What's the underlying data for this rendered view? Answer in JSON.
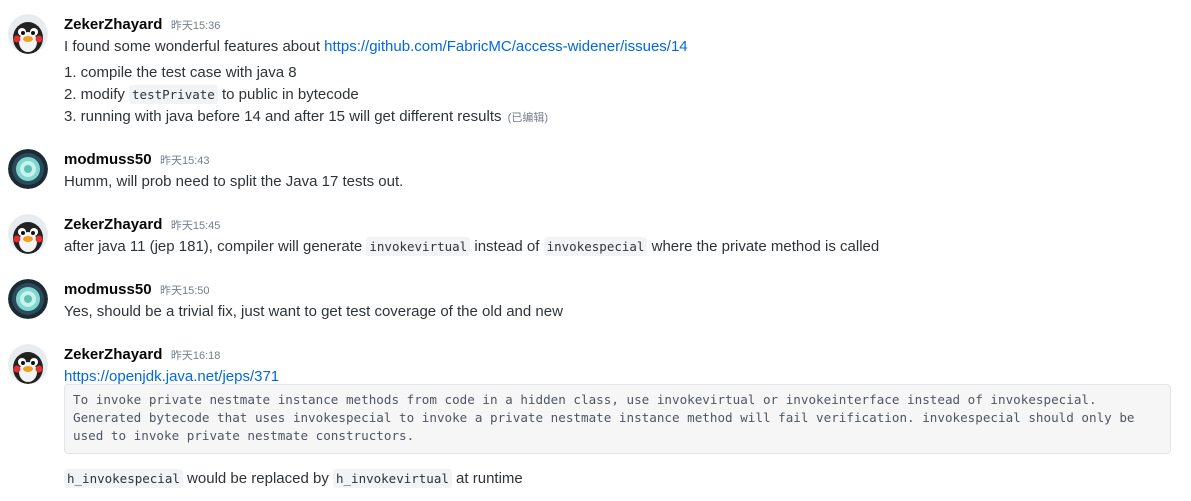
{
  "messages": [
    {
      "author": "ZekerZhayard",
      "time": "昨天15:36",
      "line1_text": "I found some wonderful features about ",
      "line1_link": "https://github.com/FabricMC/access-widener/issues/14",
      "item1": "1. compile the test case with java 8",
      "item2_pre": "2. modify ",
      "item2_code": "testPrivate",
      "item2_post": " to public in bytecode",
      "item3": "3. running with java before 14 and after 15 will get different results",
      "edited": "(已编辑)"
    },
    {
      "author": "modmuss50",
      "time": "昨天15:43",
      "text": "Humm, will prob need to split the Java 17 tests out."
    },
    {
      "author": "ZekerZhayard",
      "time": "昨天15:45",
      "pre": "after java 11 (jep 181), compiler will generate ",
      "code1": "invokevirtual",
      "mid": " instead of ",
      "code2": "invokespecial",
      "post": " where the private method is called"
    },
    {
      "author": "modmuss50",
      "time": "昨天15:50",
      "text": "Yes, should be a trivial fix, just want to get test coverage of the old and new"
    },
    {
      "author": "ZekerZhayard",
      "time": "昨天16:18",
      "link": "https://openjdk.java.net/jeps/371",
      "code_lines": [
        "To invoke private nestmate instance methods from code in a hidden class, use invokevirtual or invokeinterface instead of invokespecial.",
        "Generated bytecode that uses invokespecial to invoke a private nestmate instance method will fail verification. invokespecial should only be",
        "used to invoke private nestmate constructors."
      ],
      "last_code1": "h_invokespecial",
      "last_mid": " would be replaced by ",
      "last_code2": "h_invokevirtual",
      "last_post": " at runtime"
    }
  ]
}
